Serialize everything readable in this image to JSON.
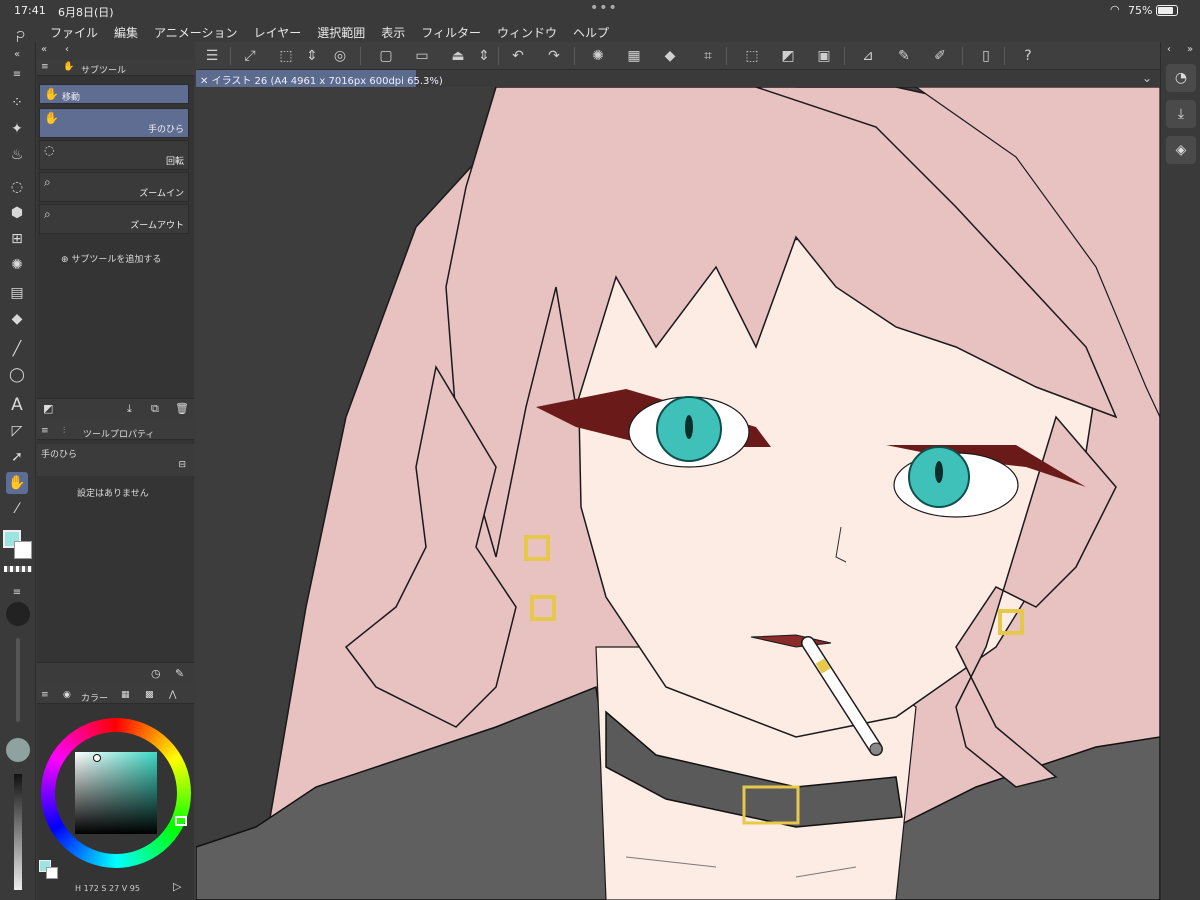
{
  "status": {
    "time": "17:41",
    "date": "6月8日(日)",
    "battery": "75%"
  },
  "menu": [
    "ファイル",
    "編集",
    "アニメーション",
    "レイヤー",
    "選択範囲",
    "表示",
    "フィルター",
    "ウィンドウ",
    "ヘルプ"
  ],
  "document_tab": "イラスト 26 (A4 4961 x 7016px 600dpi 65.3%)",
  "subtool_panel": {
    "title": "サブツール",
    "group": "移動",
    "items": [
      {
        "label": "手のひら",
        "icon": "hand-icon"
      },
      {
        "label": "回転",
        "icon": "rotate-icon"
      },
      {
        "label": "ズームイン",
        "icon": "zoom-in-icon"
      },
      {
        "label": "ズームアウト",
        "icon": "zoom-out-icon"
      }
    ],
    "add_label": "サブツールを追加する"
  },
  "tool_property": {
    "title": "ツールプロパティ",
    "tool_name": "手のひら",
    "message": "設定はありません"
  },
  "color_panel": {
    "title": "カラー",
    "readout": {
      "h": "172",
      "s": "27",
      "v": "95"
    }
  },
  "colors": {
    "main": "#9de3e0",
    "sub": "#ffffff",
    "accent": "#5d6e96",
    "hair": "#e8c1c1",
    "skin": "#fdece4",
    "eye": "#3fc1b9"
  }
}
